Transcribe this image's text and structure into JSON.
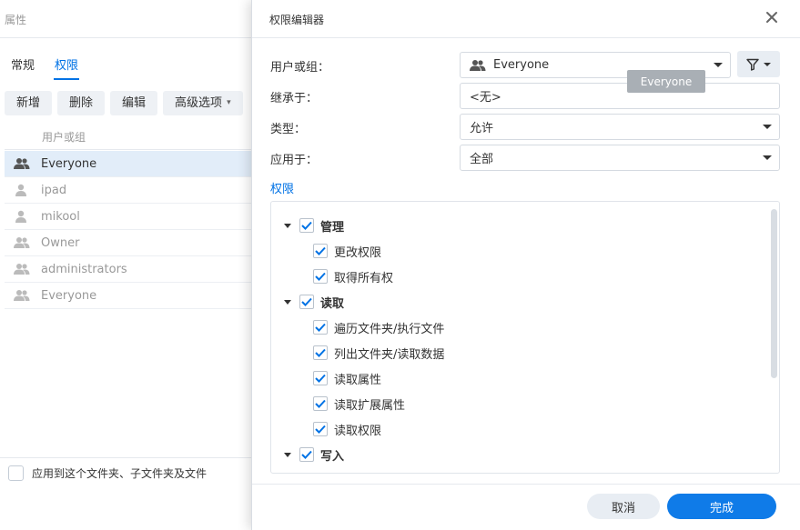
{
  "background_window": {
    "title": "属性",
    "tabs": [
      {
        "label": "常规",
        "active": false
      },
      {
        "label": "权限",
        "active": true
      }
    ],
    "toolbar": {
      "add_label": "新增",
      "delete_label": "删除",
      "edit_label": "编辑",
      "advanced_label": "高级选项"
    },
    "list_header": "用户或组",
    "rows": [
      {
        "label": "Everyone",
        "icon": "group-icon",
        "selected": true
      },
      {
        "label": "ipad",
        "icon": "user-icon",
        "selected": false
      },
      {
        "label": "mikool",
        "icon": "user-icon",
        "selected": false
      },
      {
        "label": "Owner",
        "icon": "group-icon",
        "selected": false
      },
      {
        "label": "administrators",
        "icon": "group-icon",
        "selected": false
      },
      {
        "label": "Everyone",
        "icon": "group-icon",
        "selected": false
      }
    ],
    "apply_checkbox_label": "应用到这个文件夹、子文件夹及文件"
  },
  "dialog": {
    "title": "权限编辑器",
    "fields": {
      "user_or_group": {
        "label": "用户或组：",
        "value": "Everyone"
      },
      "inherited_from": {
        "label": "继承于：",
        "value": "<无>"
      },
      "type": {
        "label": "类型：",
        "value": "允许"
      },
      "apply_to": {
        "label": "应用于：",
        "value": "全部"
      }
    },
    "tooltip": "Everyone",
    "permissions_heading": "权限",
    "permissions": [
      {
        "group": "管理",
        "checked": true,
        "items": [
          {
            "label": "更改权限",
            "checked": true
          },
          {
            "label": "取得所有权",
            "checked": true
          }
        ]
      },
      {
        "group": "读取",
        "checked": true,
        "items": [
          {
            "label": "遍历文件夹/执行文件",
            "checked": true
          },
          {
            "label": "列出文件夹/读取数据",
            "checked": true
          },
          {
            "label": "读取属性",
            "checked": true
          },
          {
            "label": "读取扩展属性",
            "checked": true
          },
          {
            "label": "读取权限",
            "checked": true
          }
        ]
      },
      {
        "group": "写入",
        "checked": true,
        "items": []
      }
    ],
    "cancel_label": "取消",
    "done_label": "完成"
  },
  "colors": {
    "accent": "#0072e5",
    "primary_button": "#0f7be8",
    "selected_row": "#e2edf9"
  }
}
